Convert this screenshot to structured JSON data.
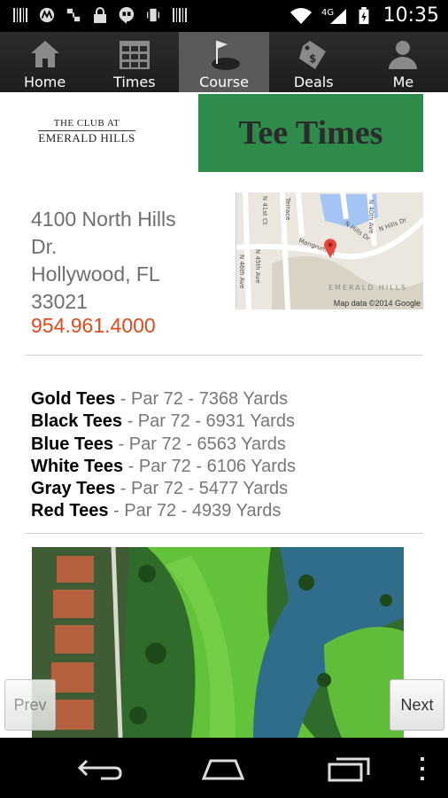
{
  "status_bar": {
    "time": "10:35",
    "network": "4G"
  },
  "tabs": [
    {
      "label": "Home",
      "icon": "home-icon",
      "active": false
    },
    {
      "label": "Times",
      "icon": "calendar-grid-icon",
      "active": false
    },
    {
      "label": "Course",
      "icon": "golf-flag-icon",
      "active": true
    },
    {
      "label": "Deals",
      "icon": "price-tag-icon",
      "active": false
    },
    {
      "label": "Me",
      "icon": "person-icon",
      "active": false
    }
  ],
  "header": {
    "logo_line1": "THE CLUB AT",
    "logo_line2": "EMERALD HILLS",
    "banner_text": "Tee Times",
    "banner_color": "#2e8b4a"
  },
  "course": {
    "address_line1": "4100 North Hills",
    "address_line2": "Dr.",
    "address_line3": "Hollywood, FL",
    "address_line4": "33021",
    "phone": "954.961.4000",
    "phone_color": "#e24a1b"
  },
  "map": {
    "streets": [
      "N 46th Ave",
      "N 45th Ave",
      "Mangrum Ct",
      "N Hills Dr",
      "N 40th Ave",
      "N Hills Dr",
      "Terrace",
      "N 41st Ct",
      "EMERALD HILLS"
    ],
    "credit": "Map data ©2014 Google"
  },
  "tees": [
    {
      "name": "Gold Tees",
      "detail": " - Par 72 - 7368 Yards"
    },
    {
      "name": "Black Tees",
      "detail": " - Par 72 - 6931 Yards"
    },
    {
      "name": "Blue Tees",
      "detail": " - Par 72 - 6563 Yards"
    },
    {
      "name": "White Tees",
      "detail": " - Par 72 - 6106 Yards"
    },
    {
      "name": "Gray Tees",
      "detail": " - Par 72 - 5477 Yards"
    },
    {
      "name": "Red Tees",
      "detail": " - Par 72 - 4939 Yards"
    }
  ],
  "buttons": {
    "prev": "Prev",
    "next": "Next"
  }
}
